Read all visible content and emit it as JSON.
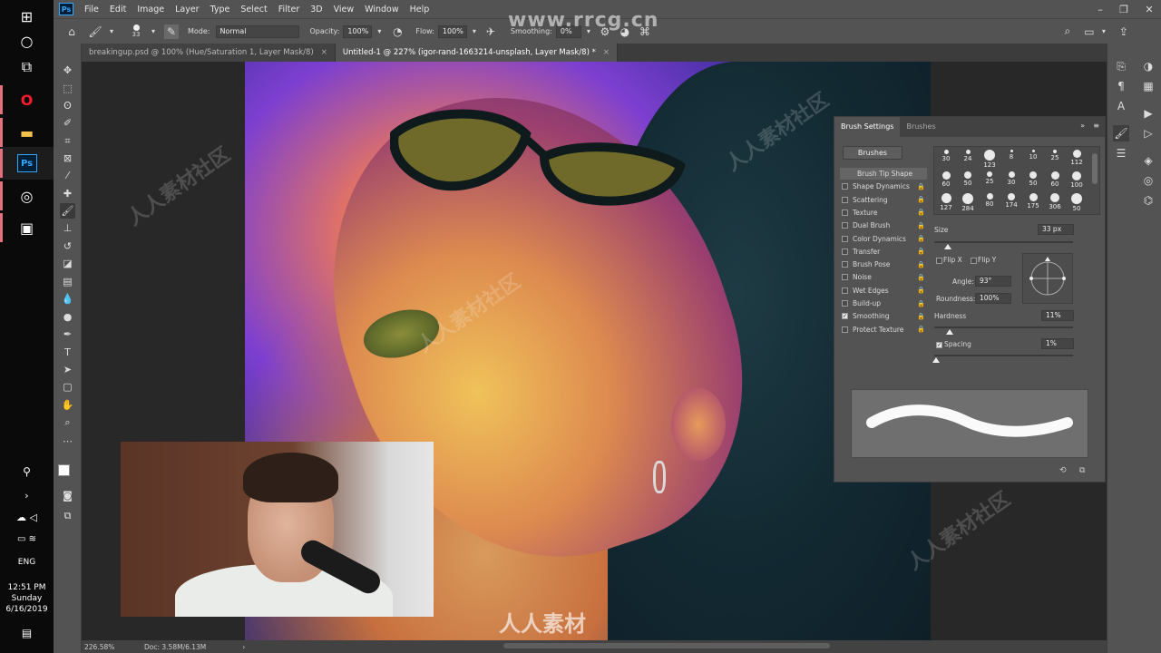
{
  "taskbar": {
    "icons": [
      "windows-icon",
      "cortana-icon",
      "task-view-icon",
      "opera-icon",
      "file-explorer-icon",
      "photoshop-icon",
      "app-icon",
      "photos-icon"
    ],
    "language": "ENG",
    "time": "12:51 PM",
    "day": "Sunday",
    "date": "6/16/2019"
  },
  "app": {
    "logo": "Ps",
    "menu": [
      "File",
      "Edit",
      "Image",
      "Layer",
      "Type",
      "Select",
      "Filter",
      "3D",
      "View",
      "Window",
      "Help"
    ]
  },
  "options": {
    "brush_size": "33",
    "mode_label": "Mode:",
    "mode_value": "Normal",
    "opacity_label": "Opacity:",
    "opacity_value": "100%",
    "flow_label": "Flow:",
    "flow_value": "100%",
    "smoothing_label": "Smoothing:",
    "smoothing_value": "0%"
  },
  "tabs": [
    {
      "label": "breakingup.psd @ 100% (Hue/Saturation 1, Layer Mask/8)",
      "active": false
    },
    {
      "label": "Untitled-1 @ 227% (igor-rand-1663214-unsplash, Layer Mask/8) *",
      "active": true
    }
  ],
  "watermark": {
    "top": "www.rrcg.cn",
    "bottom": "人人素材",
    "tile": "人人素材社区"
  },
  "brush_panel": {
    "tabs": [
      "Brush Settings",
      "Brushes"
    ],
    "brushes_button": "Brushes",
    "options": [
      {
        "label": "Brush Tip Shape",
        "checkbox": false,
        "checked": false,
        "selected": true
      },
      {
        "label": "Shape Dynamics",
        "checkbox": true,
        "checked": false
      },
      {
        "label": "Scattering",
        "checkbox": true,
        "checked": false
      },
      {
        "label": "Texture",
        "checkbox": true,
        "checked": false
      },
      {
        "label": "Dual Brush",
        "checkbox": true,
        "checked": false
      },
      {
        "label": "Color Dynamics",
        "checkbox": true,
        "checked": false
      },
      {
        "label": "Transfer",
        "checkbox": true,
        "checked": false
      },
      {
        "label": "Brush Pose",
        "checkbox": true,
        "checked": false
      },
      {
        "label": "Noise",
        "checkbox": true,
        "checked": false
      },
      {
        "label": "Wet Edges",
        "checkbox": true,
        "checked": false
      },
      {
        "label": "Build-up",
        "checkbox": true,
        "checked": false
      },
      {
        "label": "Smoothing",
        "checkbox": true,
        "checked": true
      },
      {
        "label": "Protect Texture",
        "checkbox": true,
        "checked": false
      }
    ],
    "presets": [
      "30",
      "24",
      "123",
      "8",
      "10",
      "25",
      "112",
      "60",
      "50",
      "25",
      "30",
      "50",
      "60",
      "100",
      "127",
      "284",
      "80",
      "174",
      "175",
      "306",
      "50"
    ],
    "size_label": "Size",
    "size_value": "33 px",
    "flip_x": "Flip X",
    "flip_y": "Flip Y",
    "angle_label": "Angle:",
    "angle_value": "93°",
    "roundness_label": "Roundness:",
    "roundness_value": "100%",
    "hardness_label": "Hardness",
    "hardness_value": "11%",
    "spacing_label": "Spacing",
    "spacing_value": "1%",
    "spacing_checked": true,
    "size_level": 0.1,
    "hardness_level": 0.11,
    "spacing_level": 0.01
  },
  "status": {
    "zoom": "226.58%",
    "doc": "Doc: 3.58M/6.13M"
  }
}
